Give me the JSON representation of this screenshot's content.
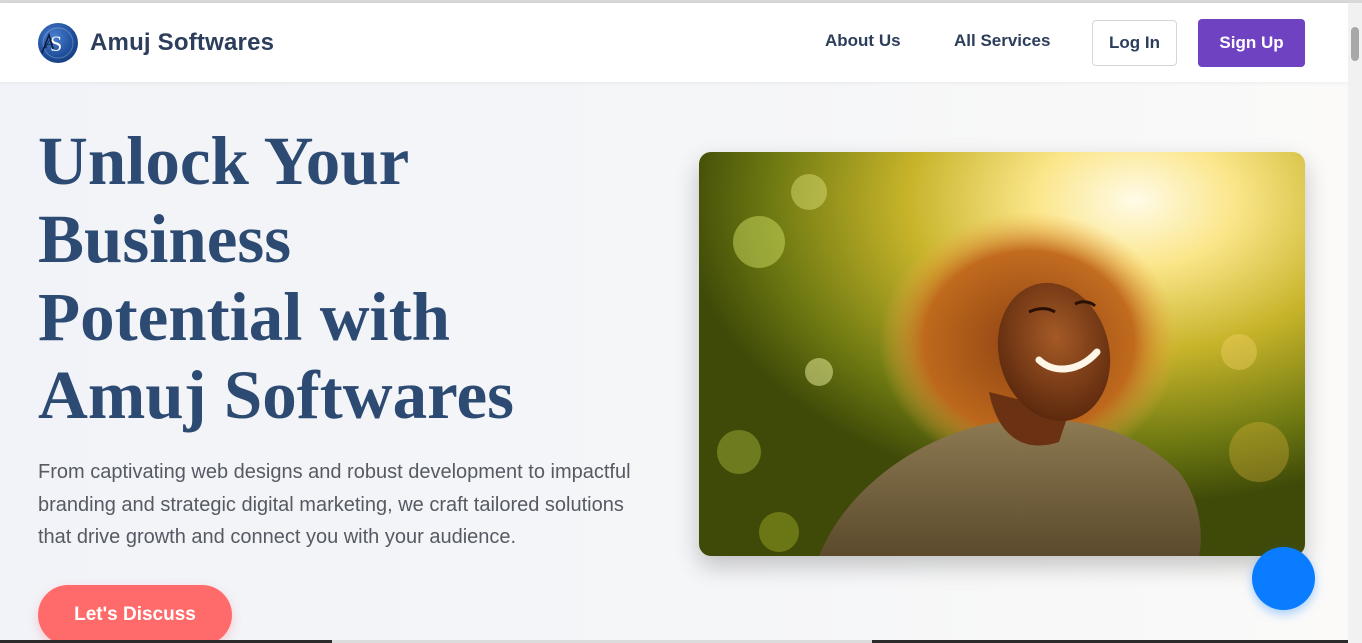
{
  "header": {
    "brand_name": "Amuj Softwares",
    "logo_letters": "AS",
    "nav": {
      "about": "About Us",
      "services": "All Services"
    },
    "login_label": "Log In",
    "signup_label": "Sign Up"
  },
  "hero": {
    "title_lines": [
      "Unlock Your",
      "Business",
      "Potential with",
      "Amuj Softwares"
    ],
    "description": "From captivating web designs and robust development to impactful branding and strategic digital marketing, we craft tailored solutions that drive growth and connect you with your audience.",
    "cta_label": "Let's Discuss"
  },
  "colors": {
    "brand_text": "#2c3e5b",
    "hero_title": "#2d4a73",
    "signup_bg": "#6f42c1",
    "cta_bg": "#ff6b6b",
    "chat_fab": "#0a7cff"
  },
  "icons": {
    "logo": "as-monogram-icon",
    "chat": "chat-bubble-icon"
  }
}
